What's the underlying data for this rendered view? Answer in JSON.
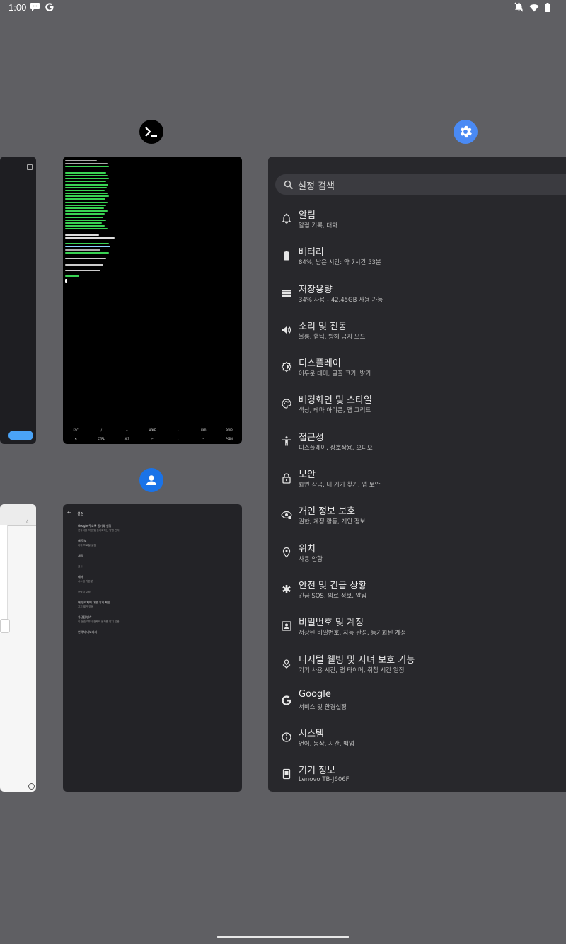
{
  "status_bar": {
    "time": "1:00"
  },
  "termux": {
    "key_row_1": [
      "ESC",
      "/",
      "―",
      "HOME",
      "↑",
      "END",
      "PGUP"
    ],
    "key_row_2": [
      "↹",
      "CTRL",
      "ALT",
      "←",
      "↓",
      "→",
      "PGDN"
    ]
  },
  "left_top_card": {
    "button_label": ""
  },
  "contacts_settings": {
    "title": "설정",
    "items": [
      {
        "title": "Google 주소록 동기화 설정",
        "sub": "연락처를 백업 및 동기화하는 방법 관리"
      },
      {
        "title": "내 정보",
        "sub": "나의 프로필 설정"
      },
      {
        "title": "계정",
        "sub": ""
      },
      {
        "title": "표시",
        "sub": ""
      },
      {
        "title": "테마",
        "sub": "시스템 기본값"
      },
      {
        "title": "연락처 수정",
        "sub": ""
      },
      {
        "title": "내 연락처에 대한 기기 제안",
        "sub": "기기 제안 받음"
      },
      {
        "title": "차단된 번호",
        "sub": "이 번호로부터 전화와 문자를 받지 않음"
      },
      {
        "title": "연락처 내보내기",
        "sub": ""
      }
    ]
  },
  "settings": {
    "search_placeholder": "설정 검색",
    "items": [
      {
        "title": "알림",
        "sub": "알림 기록, 대화",
        "icon": "bell-icon"
      },
      {
        "title": "배터리",
        "sub": "84%, 남은 시간: 약 7시간 53분",
        "icon": "battery-icon"
      },
      {
        "title": "저장용량",
        "sub": "34% 사용 - 42.45GB 사용 가능",
        "icon": "storage-icon"
      },
      {
        "title": "소리 및 진동",
        "sub": "볼륨, 햅틱, 방해 금지 모드",
        "icon": "volume-icon"
      },
      {
        "title": "디스플레이",
        "sub": "어두운 테마, 글꼴 크기, 밝기",
        "icon": "brightness-icon"
      },
      {
        "title": "배경화면 및 스타일",
        "sub": "색상, 테마 아이콘, 앱 그리드",
        "icon": "palette-icon"
      },
      {
        "title": "접근성",
        "sub": "디스플레이, 상호작용, 오디오",
        "icon": "accessibility-icon"
      },
      {
        "title": "보안",
        "sub": "화면 잠금, 내 기기 찾기, 앱 보안",
        "icon": "lock-icon"
      },
      {
        "title": "개인 정보 보호",
        "sub": "권한, 계정 활동, 개인 정보",
        "icon": "privacy-eye-icon"
      },
      {
        "title": "위치",
        "sub": "사용 안함",
        "icon": "location-pin-icon"
      },
      {
        "title": "안전 및 긴급 상황",
        "sub": "긴급 SOS, 의료 정보, 알림",
        "icon": "emergency-asterisk-icon"
      },
      {
        "title": "비밀번호 및 계정",
        "sub": "저장된 비밀번호, 자동 완성, 동기화된 계정",
        "icon": "account-box-icon"
      },
      {
        "title": "디지털 웰빙 및 자녀 보호 기능",
        "sub": "기기 사용 시간, 앱 타이머, 취침 시간 일정",
        "icon": "wellbeing-icon"
      },
      {
        "title": "Google",
        "sub": "서비스 및 환경설정",
        "icon": "google-g-icon"
      },
      {
        "title": "시스템",
        "sub": "언어, 동작, 시간, 백업",
        "icon": "info-icon"
      },
      {
        "title": "기기 정보",
        "sub": "Lenovo TB-J606F",
        "icon": "tablet-icon"
      }
    ]
  },
  "colors": {
    "background": "#5f5f63",
    "settings_accent": "#4a8af4",
    "contacts_accent": "#1a73e8",
    "terminal_green": "#39d353"
  }
}
